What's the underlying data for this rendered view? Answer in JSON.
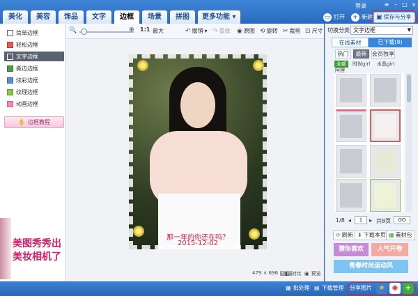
{
  "window": {
    "login": "登录"
  },
  "tabs": [
    "美化",
    "美容",
    "饰品",
    "文字",
    "边框",
    "场景",
    "拼图",
    "更多功能"
  ],
  "header_actions": {
    "open": "打开",
    "new": "新建",
    "save_share": "保存与分享"
  },
  "toolbar": {
    "zoom_ratio": "1:1",
    "maximize": "最大",
    "undo": "撤销",
    "redo": "重做",
    "original": "原图",
    "rotate": "旋转",
    "crop": "裁剪",
    "size": "尺寸"
  },
  "sidebar": {
    "items": [
      "简单边框",
      "轻松边框",
      "文字边框",
      "撕边边框",
      "炫彩边框",
      "纹理边框",
      "动画边框"
    ],
    "active_index": 2,
    "tutorial": "边框教程"
  },
  "ad": {
    "line1": "美图秀秀出",
    "line2": "美妆相机了"
  },
  "photo": {
    "caption_line1": "那一年的你还在吗？",
    "caption_line2": "2015-12-02"
  },
  "canvas_info": {
    "dimensions": "479 × 696",
    "compare": "对比",
    "preview": "预览"
  },
  "right_panel": {
    "category_label": "切换分类",
    "category_value": "文字边框",
    "tab_online": "在线素材",
    "tab_downloaded": "已下载(8)",
    "filters": [
      "热门",
      "最新",
      "会员独享"
    ],
    "active_filter": 1,
    "chips": [
      "全部",
      "时尚girl",
      "水晶girl",
      "阿狸"
    ],
    "pager": {
      "page_text": "1/8",
      "input_value": "1",
      "total": "共8页",
      "go": "GO"
    },
    "actions": {
      "refresh": "刷新",
      "download_page": "下载本页",
      "material_pack": "素材包"
    },
    "promos": {
      "p1": "猜你喜欢",
      "p2": "人气开卷",
      "p3": "青春时尚运动风"
    }
  },
  "statusbar": {
    "batch": "批处理",
    "download_mgr": "下载管理",
    "share_img": "分享图片"
  },
  "colors": {
    "accent": "#2a69bd",
    "highlight": "#d02040",
    "caption": "#d0204a"
  }
}
